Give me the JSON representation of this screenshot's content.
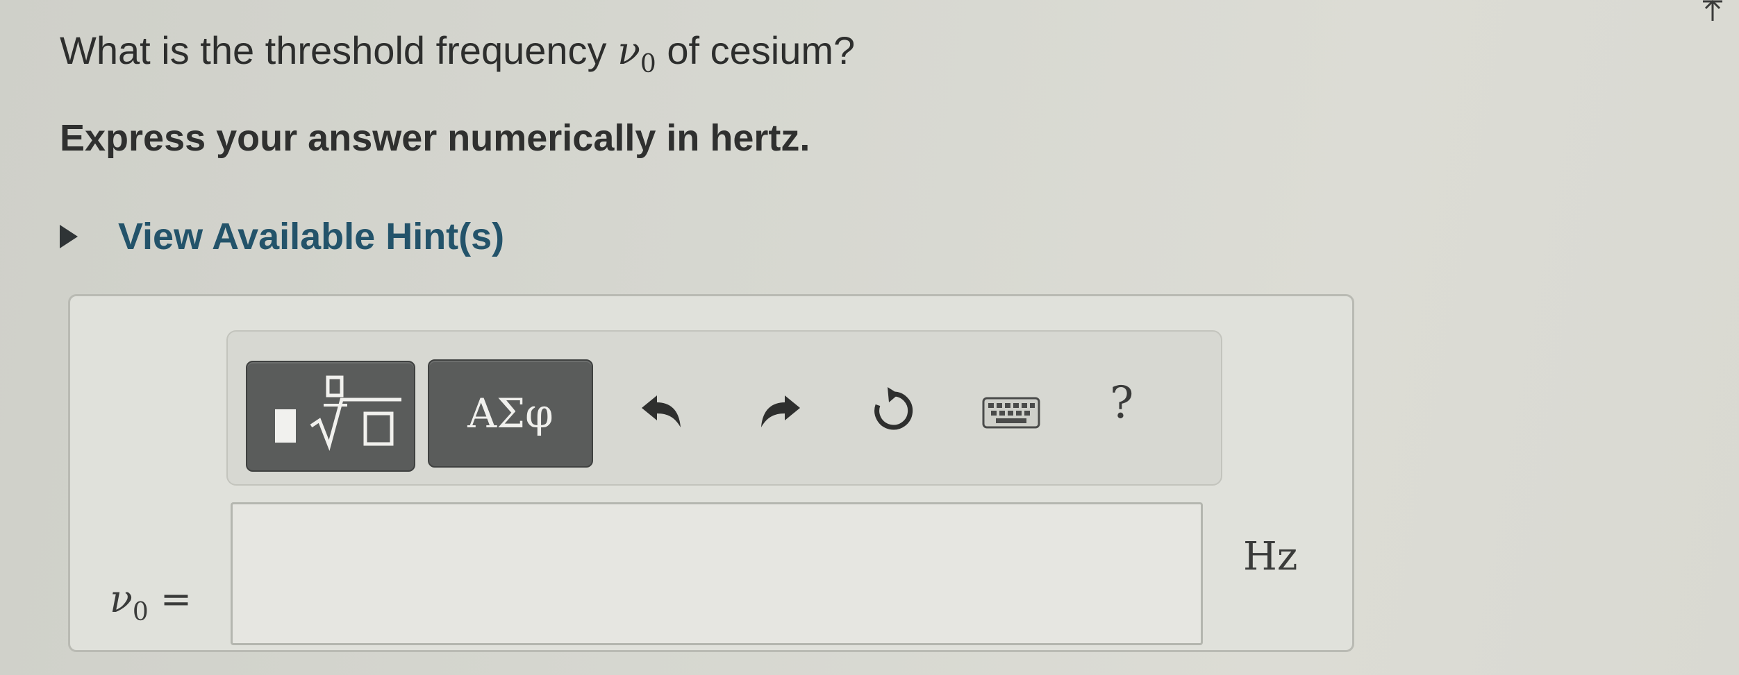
{
  "question": {
    "text_before": "What is the threshold frequency ",
    "symbol": "ν",
    "subscript": "0",
    "text_after": " of cesium?"
  },
  "instruction": "Express your answer numerically in hertz.",
  "hint": {
    "label": "View Available Hint(s)"
  },
  "toolbar": {
    "templates_icon": "fraction-root-template-icon",
    "greek_label": "ΑΣφ",
    "undo_icon": "undo-icon",
    "redo_icon": "redo-icon",
    "reset_icon": "reset-icon",
    "keyboard_icon": "keyboard-icon",
    "help_label": "?"
  },
  "answer": {
    "variable_symbol": "ν",
    "variable_subscript": "0",
    "equals": " =",
    "value": "",
    "unit": "Hz"
  }
}
